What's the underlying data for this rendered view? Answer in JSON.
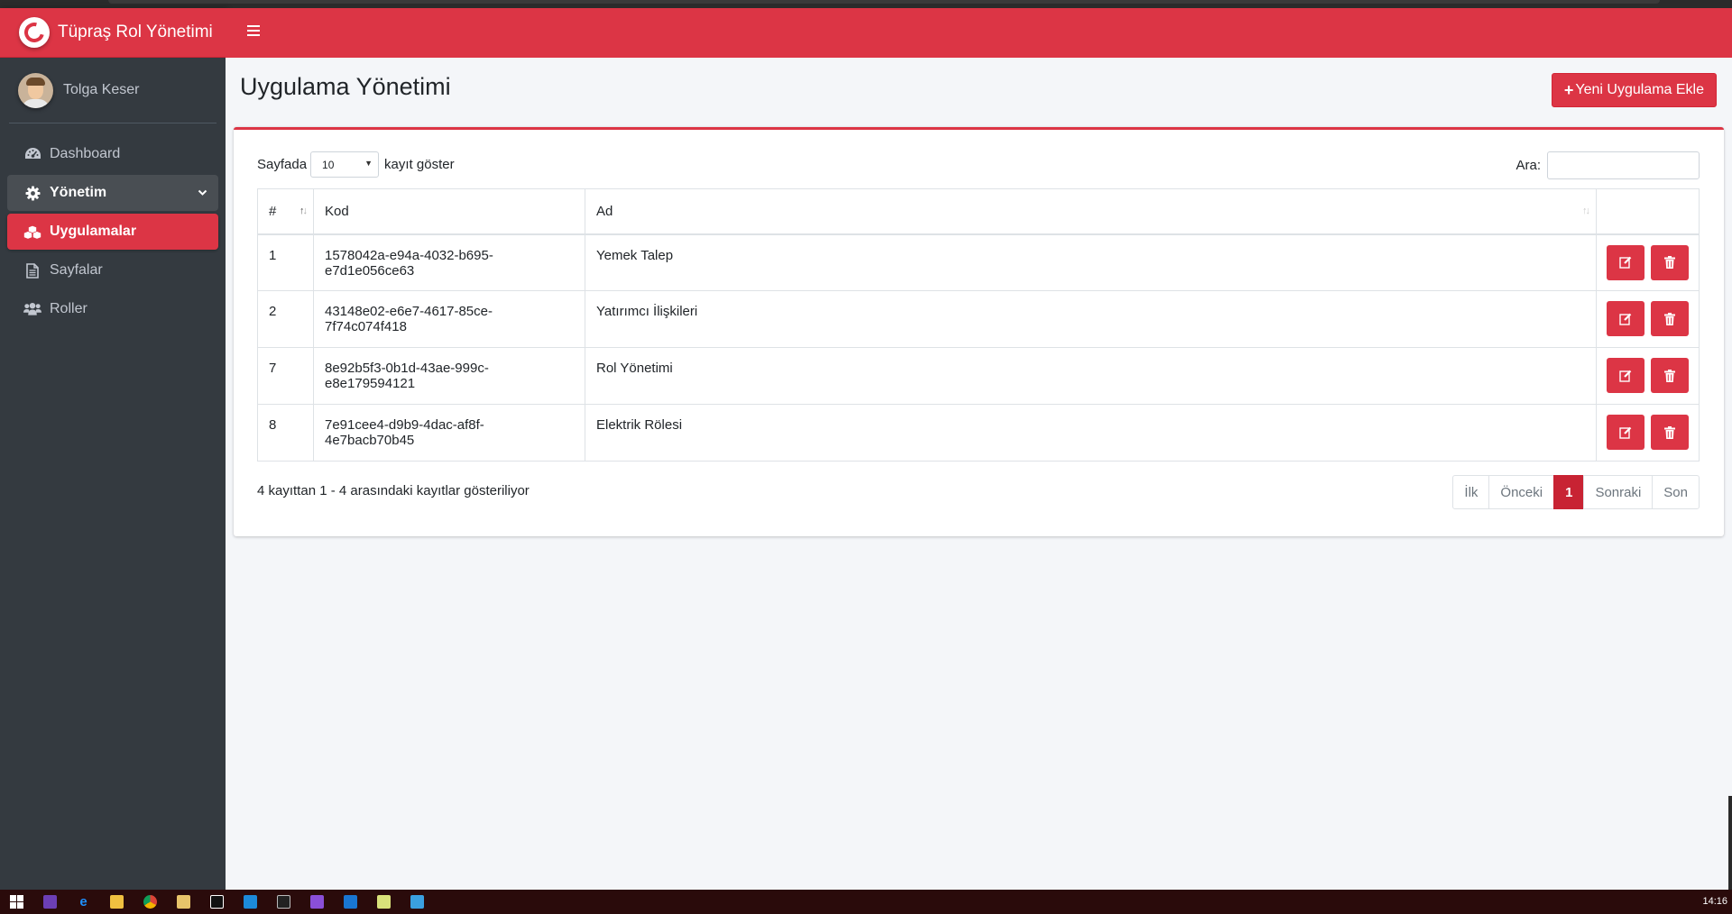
{
  "app": {
    "title": "Tüpraş Rol Yönetimi"
  },
  "user": {
    "name": "Tolga Keser"
  },
  "sidebar": {
    "items": [
      {
        "label": "Dashboard",
        "icon": "dashboard-icon"
      },
      {
        "label": "Yönetim",
        "icon": "gear-icon"
      },
      {
        "label": "Uygulamalar",
        "icon": "cubes-icon"
      },
      {
        "label": "Sayfalar",
        "icon": "file-icon"
      },
      {
        "label": "Roller",
        "icon": "users-icon"
      }
    ]
  },
  "page": {
    "title": "Uygulama Yönetimi",
    "new_button": "Yeni Uygulama Ekle"
  },
  "table_controls": {
    "length_prefix": "Sayfada",
    "length_value": "10",
    "length_suffix": "kayıt göster",
    "search_label": "Ara:"
  },
  "table": {
    "headers": [
      "#",
      "Kod",
      "Ad"
    ],
    "rows": [
      {
        "id": "1",
        "code": "1578042a-e94a-4032-b695-e7d1e056ce63",
        "name": "Yemek Talep"
      },
      {
        "id": "2",
        "code": "43148e02-e6e7-4617-85ce-7f74c074f418",
        "name": "Yatırımcı İlişkileri"
      },
      {
        "id": "7",
        "code": "8e92b5f3-0b1d-43ae-999c-e8e179594121",
        "name": "Rol Yönetimi"
      },
      {
        "id": "8",
        "code": "7e91cee4-d9b9-4dac-af8f-4e7bacb70b45",
        "name": "Elektrik Rölesi"
      }
    ]
  },
  "footer": {
    "info": "4 kayıttan 1 - 4 arasındaki kayıtlar gösteriliyor",
    "pagination": [
      "İlk",
      "Önceki",
      "1",
      "Sonraki",
      "Son"
    ]
  },
  "taskbar": {
    "clock": "14:16"
  },
  "colors": {
    "accent": "#dc3545",
    "sidebar": "#343a40"
  }
}
